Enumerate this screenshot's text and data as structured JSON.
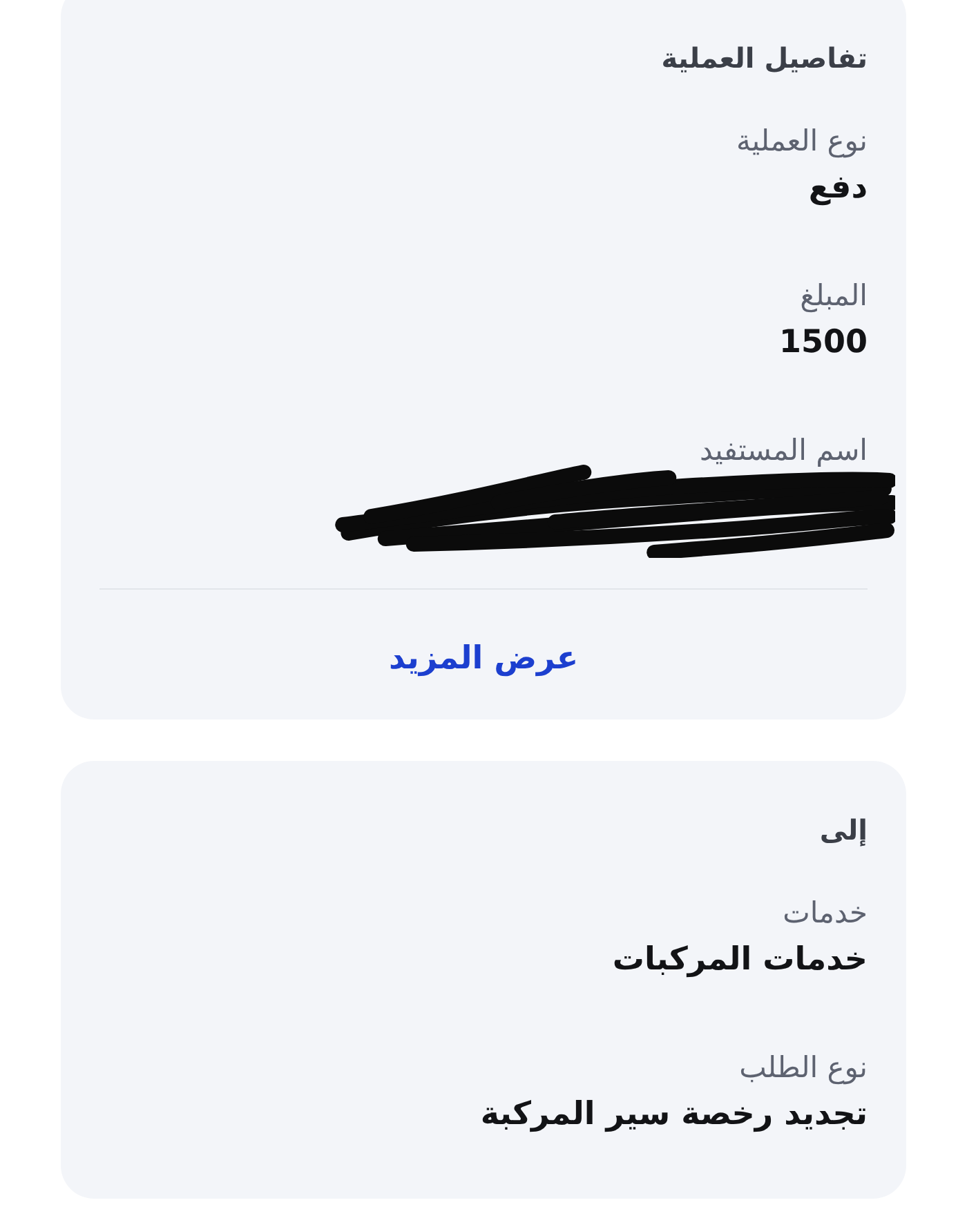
{
  "sections": [
    {
      "title": "تفاصيل العملية",
      "fields": [
        {
          "label": "نوع العملية",
          "value": "دفع",
          "redacted": false
        },
        {
          "label": "المبلغ",
          "value": "1500",
          "redacted": false
        },
        {
          "label": "اسم المستفيد",
          "redacted": true
        }
      ],
      "more_link": "عرض المزيد"
    },
    {
      "title": "إلى",
      "fields": [
        {
          "label": "خدمات",
          "value": "خدمات المركبات",
          "redacted": false
        },
        {
          "label": "نوع الطلب",
          "value": "تجديد رخصة سير المركبة",
          "redacted": false
        }
      ]
    }
  ]
}
